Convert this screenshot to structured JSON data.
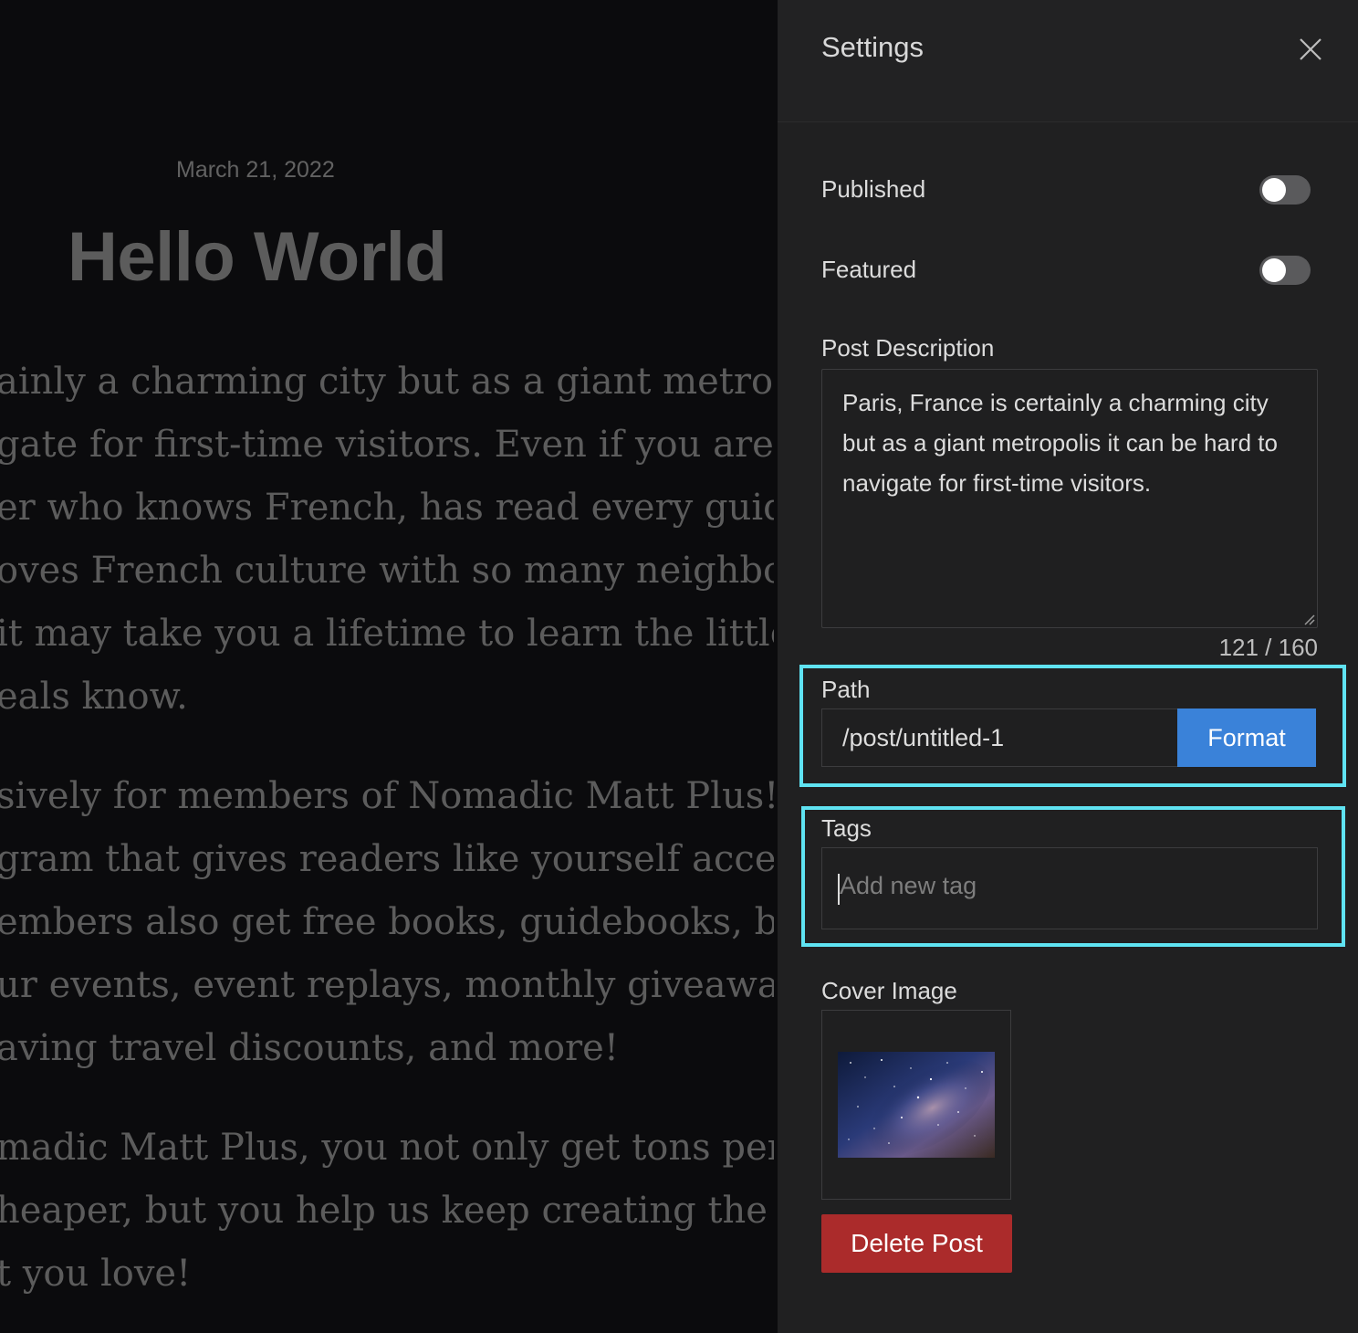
{
  "article": {
    "date": "March 21, 2022",
    "title": "Hello World",
    "paragraphs": [
      [
        "ainly a charming city but as a giant metropolis",
        "gate for first-time visitors. Even if you are an",
        "er who knows French, has read every guidebook",
        "oves French culture with so many neighborhoods",
        "it may take you a lifetime to learn the little nooks",
        "eals know."
      ],
      [
        "sively for members of Nomadic Matt Plus! It is",
        "gram that gives readers like yourself access to",
        "embers also get free books, guidebooks, blogging",
        "ur events, event replays, monthly giveaways,",
        "aving travel discounts, and more!"
      ],
      [
        "madic Matt Plus, you not only get tons perks to",
        "heaper, but you help us keep creating the in-",
        "t you love!"
      ]
    ]
  },
  "settings": {
    "title": "Settings",
    "close_icon": "close-icon",
    "published": {
      "label": "Published",
      "on": false
    },
    "featured": {
      "label": "Featured",
      "on": false
    },
    "description": {
      "label": "Post Description",
      "value": "Paris, France is certainly a charming city but as a giant metropolis it can be hard to navigate for first-time visitors.",
      "count": "121 / 160"
    },
    "path": {
      "label": "Path",
      "value": "/post/untitled-1",
      "button": "Format"
    },
    "tags": {
      "label": "Tags",
      "placeholder": "Add new tag"
    },
    "cover": {
      "label": "Cover Image",
      "icon": "starry-sky-image"
    },
    "delete_label": "Delete Post"
  },
  "colors": {
    "accent": "#3a82d9",
    "danger": "#ab2b2b",
    "highlight": "#5fe3f2",
    "panel_bg": "#202021",
    "page_bg": "#0b0b0d"
  }
}
